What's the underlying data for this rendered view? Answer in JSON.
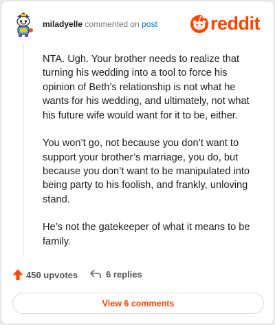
{
  "comment": {
    "username": "miladyelle",
    "commented_on_text": "commented on",
    "post_link_text": "post",
    "paragraphs": [
      "NTA. Ugh. Your brother needs to realize that turning his wedding into a tool to force his opinion of Beth’s relationship is not what he wants for his wedding, and ultimately, not what his future wife would want for it to be, either.",
      "You won’t go, not because you don’t want to support your brother’s marriage, you do, but because you don’t want to be manipulated into being party to his foolish, and frankly, unloving stand.",
      "He’s not the gatekeeper of what it means to be family."
    ]
  },
  "brand": {
    "name": "reddit",
    "color": "#ff4500",
    "icon": "reddit-snoo-icon"
  },
  "actions": {
    "upvotes": "450 upvotes",
    "replies": "6 replies",
    "upvote_icon": "upvote-arrow-icon",
    "reply_icon": "reply-arrow-icon"
  },
  "view_comments": "View 6 comments"
}
